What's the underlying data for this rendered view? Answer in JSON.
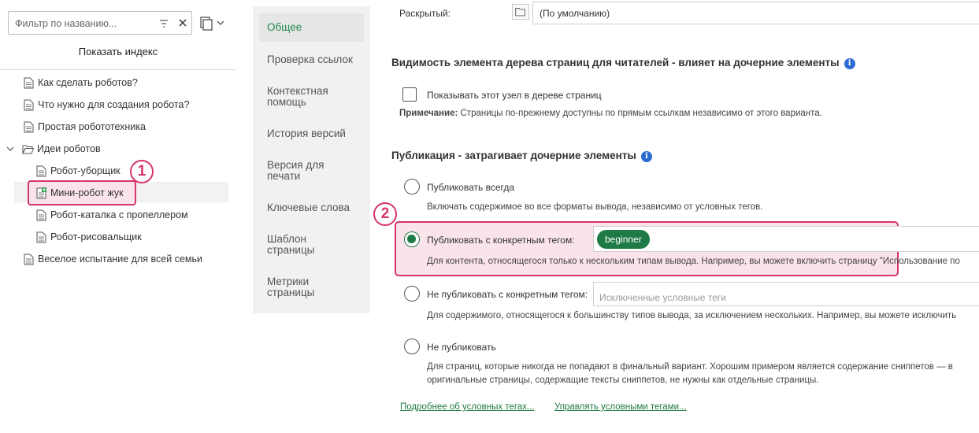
{
  "sidebar": {
    "filter_placeholder": "Фильтр по названию...",
    "show_index_label": "Показать индекс",
    "tree": [
      {
        "label": "Как сделать роботов?"
      },
      {
        "label": "Что нужно для создания робота?"
      },
      {
        "label": "Простая робототехника"
      },
      {
        "label": "Идеи роботов"
      },
      {
        "label": "Робот-уборщик"
      },
      {
        "label": "Мини-робот жук"
      },
      {
        "label": "Робот-каталка с пропеллером"
      },
      {
        "label": "Робот-рисовальщик"
      },
      {
        "label": "Веселое испытание для всей семьи"
      }
    ],
    "badge_1": "1"
  },
  "nav": {
    "items": [
      {
        "label": "Общее"
      },
      {
        "label": "Проверка ссылок"
      },
      {
        "label": "Контекстная помощь"
      },
      {
        "label": "История версий"
      },
      {
        "label": "Версия для печати"
      },
      {
        "label": "Ключевые слова"
      },
      {
        "label": "Шаблон страницы"
      },
      {
        "label": "Метрики страницы"
      }
    ]
  },
  "content": {
    "expanded_label": "Раскрытый:",
    "expanded_value": "(По умолчанию)",
    "visibility_title": "Видимость элемента дерева страниц для читателей - влияет на дочерние элементы",
    "show_node_label": "Показывать этот узел в дереве страниц",
    "note_bold": "Примечание:",
    "note_text": " Страницы по-прежнему доступны по прямым ссылкам независимо от этого варианта.",
    "publish_title": "Публикация - затрагивает дочерние элементы",
    "badge_2": "2",
    "opt_always": "Публиковать всегда",
    "opt_always_desc": "Включать содержимое во все форматы вывода, независимо от условных тегов.",
    "opt_with_tag": "Публиковать с конкретным тегом:",
    "tag_value": "beginner",
    "opt_with_tag_desc": "Для контента, относящегося только к нескольким типам вывода. Например, вы можете включить страницу \"Использование по",
    "opt_without_tag": "Не публиковать с конкретным тегом:",
    "excluded_placeholder": "Исключенные условные теги",
    "opt_without_tag_desc": "Для содержимого, относящегося к большинству типов вывода, за исключением нескольких. Например, вы можете исключить",
    "opt_never": "Не публиковать",
    "opt_never_desc_1": "Для страниц, которые никогда не попадают в финальный вариант. Хорошим примером является содержание сниппетов — в",
    "opt_never_desc_2": "оригинальные страницы, содержащие тексты сниппетов, не нужны как отдельные страницы.",
    "link_more": "Подробнее об условных тегах...",
    "link_manage": "Управлять условными тегами..."
  },
  "colors": {
    "accent_green": "#1f7a45",
    "highlight_pink": "#d6346f",
    "info_blue": "#2b6cd3"
  }
}
